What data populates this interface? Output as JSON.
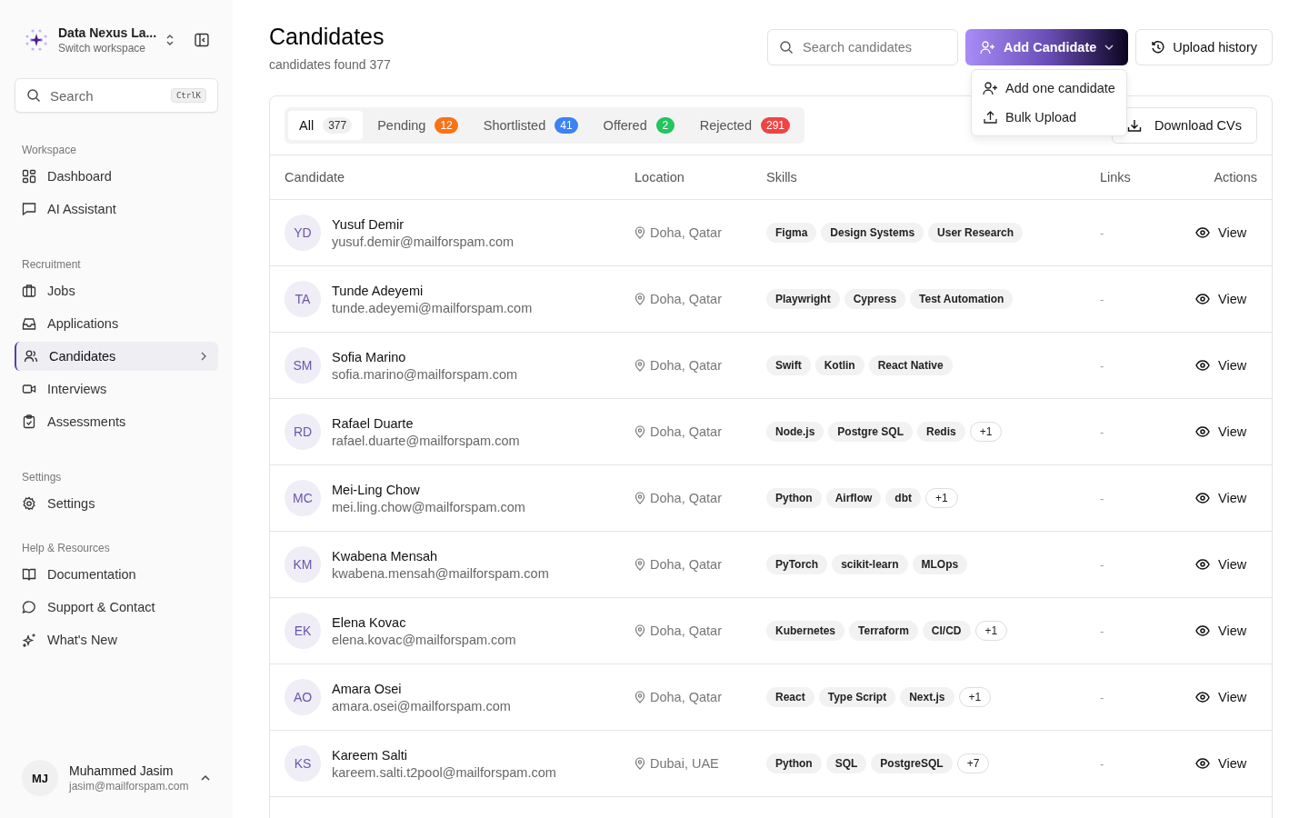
{
  "workspace": {
    "name": "Data Nexus La...",
    "subtitle": "Switch workspace"
  },
  "sidebar_search": {
    "placeholder": "Search",
    "shortcut": "CtrlK"
  },
  "sidebar": [
    {
      "heading": "Workspace",
      "items": [
        {
          "label": "Dashboard",
          "selected": false
        },
        {
          "label": "AI Assistant",
          "selected": false
        }
      ]
    },
    {
      "heading": "Recruitment",
      "items": [
        {
          "label": "Jobs",
          "selected": false
        },
        {
          "label": "Applications",
          "selected": false
        },
        {
          "label": "Candidates",
          "selected": true
        },
        {
          "label": "Interviews",
          "selected": false
        },
        {
          "label": "Assessments",
          "selected": false
        }
      ]
    },
    {
      "heading": "Settings",
      "items": [
        {
          "label": "Settings",
          "selected": false
        }
      ]
    },
    {
      "heading": "Help & Resources",
      "items": [
        {
          "label": "Documentation",
          "selected": false
        },
        {
          "label": "Support & Contact",
          "selected": false
        },
        {
          "label": "What's New",
          "selected": false
        }
      ]
    }
  ],
  "user": {
    "initials": "MJ",
    "name": "Muhammed Jasim",
    "email": "jasim@mailforspam.com"
  },
  "page": {
    "title": "Candidates",
    "subtitle": "candidates found 377"
  },
  "search": {
    "placeholder": "Search candidates"
  },
  "add_button": {
    "label": "Add Candidate",
    "expanded": true
  },
  "add_menu": [
    "Add one candidate",
    "Bulk Upload"
  ],
  "upload_history": "Upload history",
  "download_button": "Download CVs",
  "tabs": [
    {
      "label": "All",
      "count": "377",
      "selected": true,
      "color": "#f0f0f0"
    },
    {
      "label": "Pending",
      "count": "12",
      "selected": false,
      "color": "#f97316"
    },
    {
      "label": "Shortlisted",
      "count": "41",
      "selected": false,
      "color": "#3b82f6"
    },
    {
      "label": "Offered",
      "count": "2",
      "selected": false,
      "color": "#22c55e"
    },
    {
      "label": "Rejected",
      "count": "291",
      "selected": false,
      "color": "#ef4444"
    }
  ],
  "table": {
    "columns": [
      "Candidate",
      "Location",
      "Skills",
      "Links",
      "Actions"
    ],
    "rows": [
      {
        "initials": "YD",
        "name": "Yusuf Demir",
        "email": "yusuf.demir@mailforspam.com",
        "location": "Doha, Qatar",
        "skills": [
          {
            "label": "Figma",
            "kind": "skill"
          },
          {
            "label": "Design Systems",
            "kind": "skill"
          },
          {
            "label": "User Research",
            "kind": "skill"
          }
        ],
        "links": "-",
        "action": "View"
      },
      {
        "initials": "TA",
        "name": "Tunde Adeyemi",
        "email": "tunde.adeyemi@mailforspam.com",
        "location": "Doha, Qatar",
        "skills": [
          {
            "label": "Playwright",
            "kind": "skill"
          },
          {
            "label": "Cypress",
            "kind": "skill"
          },
          {
            "label": "Test Automation",
            "kind": "skill"
          }
        ],
        "links": "-",
        "action": "View"
      },
      {
        "initials": "SM",
        "name": "Sofia Marino",
        "email": "sofia.marino@mailforspam.com",
        "location": "Doha, Qatar",
        "skills": [
          {
            "label": "Swift",
            "kind": "skill"
          },
          {
            "label": "Kotlin",
            "kind": "skill"
          },
          {
            "label": "React Native",
            "kind": "skill"
          }
        ],
        "links": "-",
        "action": "View"
      },
      {
        "initials": "RD",
        "name": "Rafael Duarte",
        "email": "rafael.duarte@mailforspam.com",
        "location": "Doha, Qatar",
        "skills": [
          {
            "label": "Node.js",
            "kind": "skill"
          },
          {
            "label": "Postgre SQL",
            "kind": "skill"
          },
          {
            "label": "Redis",
            "kind": "skill"
          },
          {
            "label": "+1",
            "kind": "more"
          }
        ],
        "links": "-",
        "action": "View"
      },
      {
        "initials": "MC",
        "name": "Mei-Ling Chow",
        "email": "mei.ling.chow@mailforspam.com",
        "location": "Doha, Qatar",
        "skills": [
          {
            "label": "Python",
            "kind": "skill"
          },
          {
            "label": "Airflow",
            "kind": "skill"
          },
          {
            "label": "dbt",
            "kind": "skill"
          },
          {
            "label": "+1",
            "kind": "more"
          }
        ],
        "links": "-",
        "action": "View"
      },
      {
        "initials": "KM",
        "name": "Kwabena Mensah",
        "email": "kwabena.mensah@mailforspam.com",
        "location": "Doha, Qatar",
        "skills": [
          {
            "label": "PyTorch",
            "kind": "skill"
          },
          {
            "label": "scikit-learn",
            "kind": "skill"
          },
          {
            "label": "MLOps",
            "kind": "skill"
          }
        ],
        "links": "-",
        "action": "View"
      },
      {
        "initials": "EK",
        "name": "Elena Kovac",
        "email": "elena.kovac@mailforspam.com",
        "location": "Doha, Qatar",
        "skills": [
          {
            "label": "Kubernetes",
            "kind": "skill"
          },
          {
            "label": "Terraform",
            "kind": "skill"
          },
          {
            "label": "CI/CD",
            "kind": "skill"
          },
          {
            "label": "+1",
            "kind": "more"
          }
        ],
        "links": "-",
        "action": "View"
      },
      {
        "initials": "AO",
        "name": "Amara Osei",
        "email": "amara.osei@mailforspam.com",
        "location": "Doha, Qatar",
        "skills": [
          {
            "label": "React",
            "kind": "skill"
          },
          {
            "label": "Type Script",
            "kind": "skill"
          },
          {
            "label": "Next.js",
            "kind": "skill"
          },
          {
            "label": "+1",
            "kind": "more"
          }
        ],
        "links": "-",
        "action": "View"
      },
      {
        "initials": "KS",
        "name": "Kareem Salti",
        "email": "kareem.salti.t2pool@mailforspam.com",
        "location": "Dubai, UAE",
        "skills": [
          {
            "label": "Python",
            "kind": "skill"
          },
          {
            "label": "SQL",
            "kind": "skill"
          },
          {
            "label": "PostgreSQL",
            "kind": "skill"
          },
          {
            "label": "+7",
            "kind": "more"
          }
        ],
        "links": "-",
        "action": "View"
      }
    ]
  }
}
